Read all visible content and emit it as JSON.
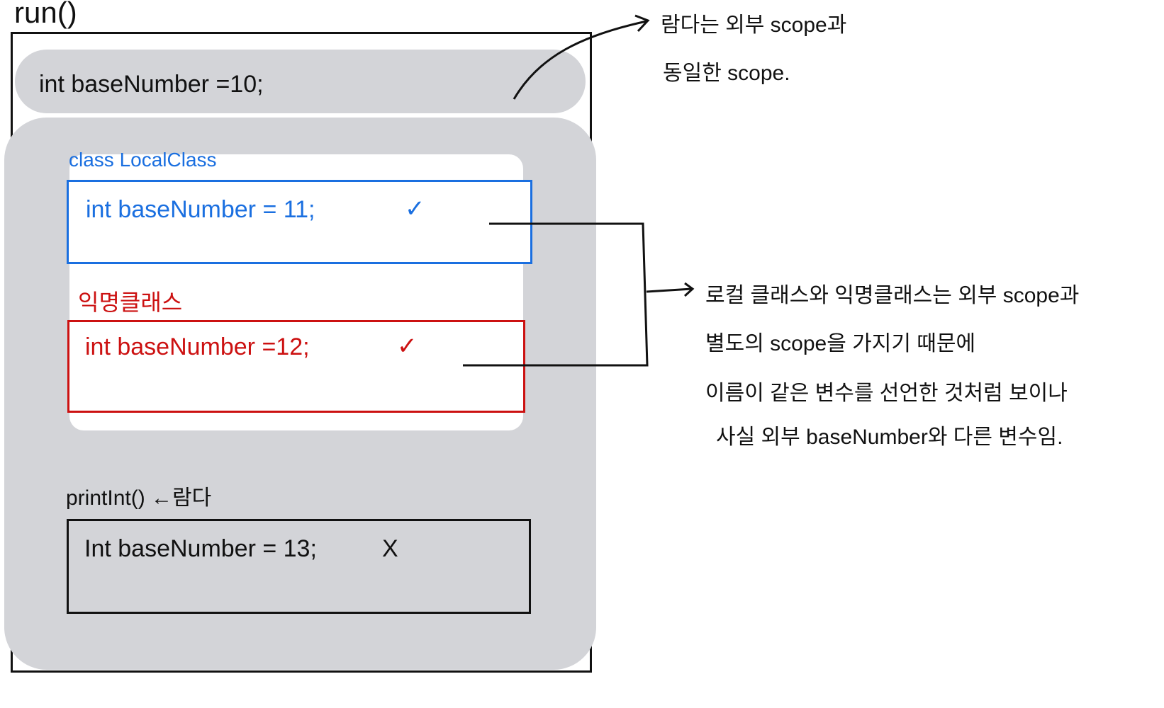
{
  "method_title": "run()",
  "outer_declaration": "int baseNumber =10;",
  "local_class": {
    "label": "class LocalClass",
    "declaration": "int baseNumber = 11;",
    "mark": "✓",
    "color": "#1a6fe0"
  },
  "anonymous_class": {
    "label": "익명클래스",
    "declaration": "int baseNumber =12;",
    "mark": "✓",
    "color": "#cc1111"
  },
  "lambda": {
    "label": "printInt()",
    "arrow": "←",
    "annotation": "람다",
    "declaration": "Int baseNumber = 13;",
    "mark": "X"
  },
  "notes": {
    "lambda_note": [
      "람다는 외부 scope과",
      "동일한 scope."
    ],
    "class_note": [
      "로컬 클래스와 익명클래스는 외부 scope과",
      "별도의 scope을 가지기 때문에",
      "이름이 같은 변수를 선언한 것처럼 보이나",
      "사실 외부 baseNumber와 다른 변수임."
    ]
  }
}
